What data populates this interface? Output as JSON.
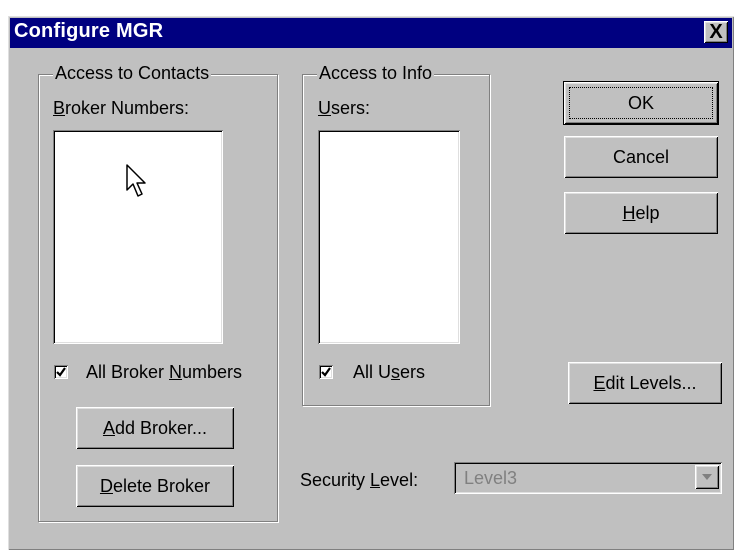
{
  "window": {
    "title": "Configure MGR",
    "close_glyph": "X"
  },
  "contacts_group": {
    "legend": "Access to Contacts",
    "list_label_u": "B",
    "list_label_rest": "roker Numbers:",
    "all_checkbox": {
      "pre": "All Broker ",
      "u": "N",
      "post": "umbers",
      "checked": true
    },
    "add_button": {
      "u": "A",
      "rest": "dd Broker..."
    },
    "delete_button": {
      "u": "D",
      "rest": "elete Broker"
    }
  },
  "info_group": {
    "legend": "Access to Info",
    "list_label_u": "U",
    "list_label_rest": "sers:",
    "all_checkbox": {
      "pre": "All U",
      "u": "s",
      "post": "ers",
      "checked": true
    }
  },
  "buttons": {
    "ok": "OK",
    "cancel": "Cancel",
    "help_u": "H",
    "help_rest": "elp",
    "edit_levels_u": "E",
    "edit_levels_rest": "dit Levels..."
  },
  "security": {
    "label_pre": "Security ",
    "label_u": "L",
    "label_post": "evel:",
    "value": "Level3",
    "disabled": true
  }
}
